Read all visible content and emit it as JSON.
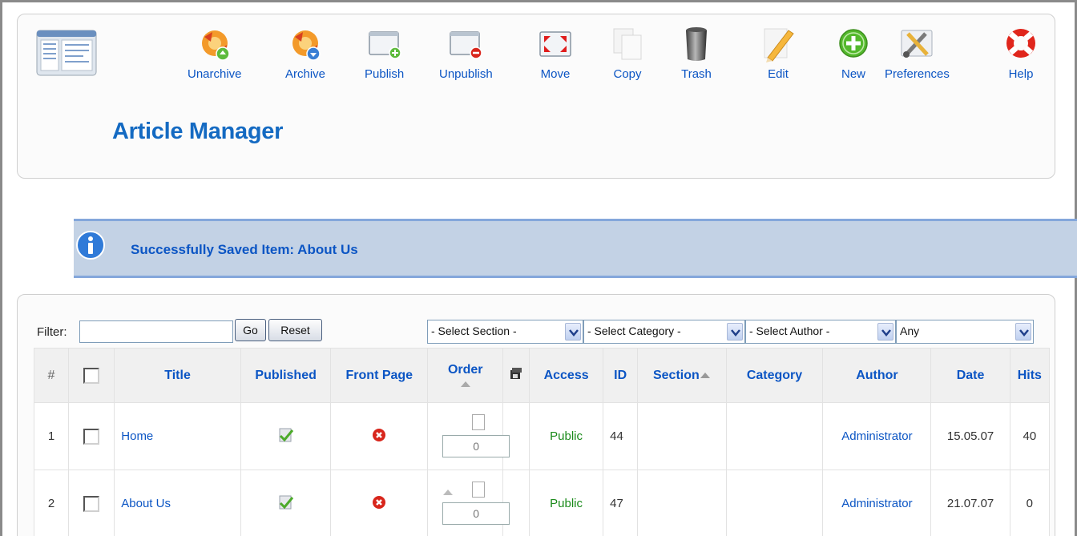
{
  "toolbar": {
    "buttons": [
      {
        "label": "Unarchive",
        "icon": "unarchive-icon"
      },
      {
        "label": "Archive",
        "icon": "archive-icon"
      },
      {
        "label": "Publish",
        "icon": "publish-icon"
      },
      {
        "label": "Unpublish",
        "icon": "unpublish-icon"
      },
      {
        "label": "Move",
        "icon": "move-icon"
      },
      {
        "label": "Copy",
        "icon": "copy-icon"
      },
      {
        "label": "Trash",
        "icon": "trash-icon"
      },
      {
        "label": "Edit",
        "icon": "edit-icon"
      },
      {
        "label": "New",
        "icon": "new-icon"
      },
      {
        "label": "Preferences",
        "icon": "preferences-icon"
      },
      {
        "label": "Help",
        "icon": "help-icon"
      }
    ]
  },
  "page_title": "Article Manager",
  "message": "Successfully Saved Item: About Us",
  "filter": {
    "label": "Filter:",
    "value": "",
    "go_label": "Go",
    "reset_label": "Reset"
  },
  "selects": {
    "section": "- Select Section -",
    "category": "- Select Category -",
    "author": "- Select Author -",
    "state": "Any"
  },
  "table": {
    "headers": {
      "num": "#",
      "title": "Title",
      "published": "Published",
      "front_page": "Front Page",
      "order": "Order",
      "access": "Access",
      "id": "ID",
      "section": "Section",
      "category": "Category",
      "author": "Author",
      "date": "Date",
      "hits": "Hits"
    },
    "rows": [
      {
        "num": "1",
        "title": "Home",
        "published": true,
        "front_page": false,
        "order": "0",
        "access": "Public",
        "id": "44",
        "section": "",
        "category": "",
        "author": "Administrator",
        "date": "15.05.07",
        "hits": "40"
      },
      {
        "num": "2",
        "title": "About Us",
        "published": true,
        "front_page": false,
        "order": "0",
        "access": "Public",
        "id": "47",
        "section": "",
        "category": "",
        "author": "Administrator",
        "date": "21.07.07",
        "hits": "0"
      }
    ]
  },
  "colors": {
    "link": "#0b55c4",
    "title": "#146ac2",
    "access": "#1a8a1a",
    "message_bg": "#c3d2e5"
  }
}
